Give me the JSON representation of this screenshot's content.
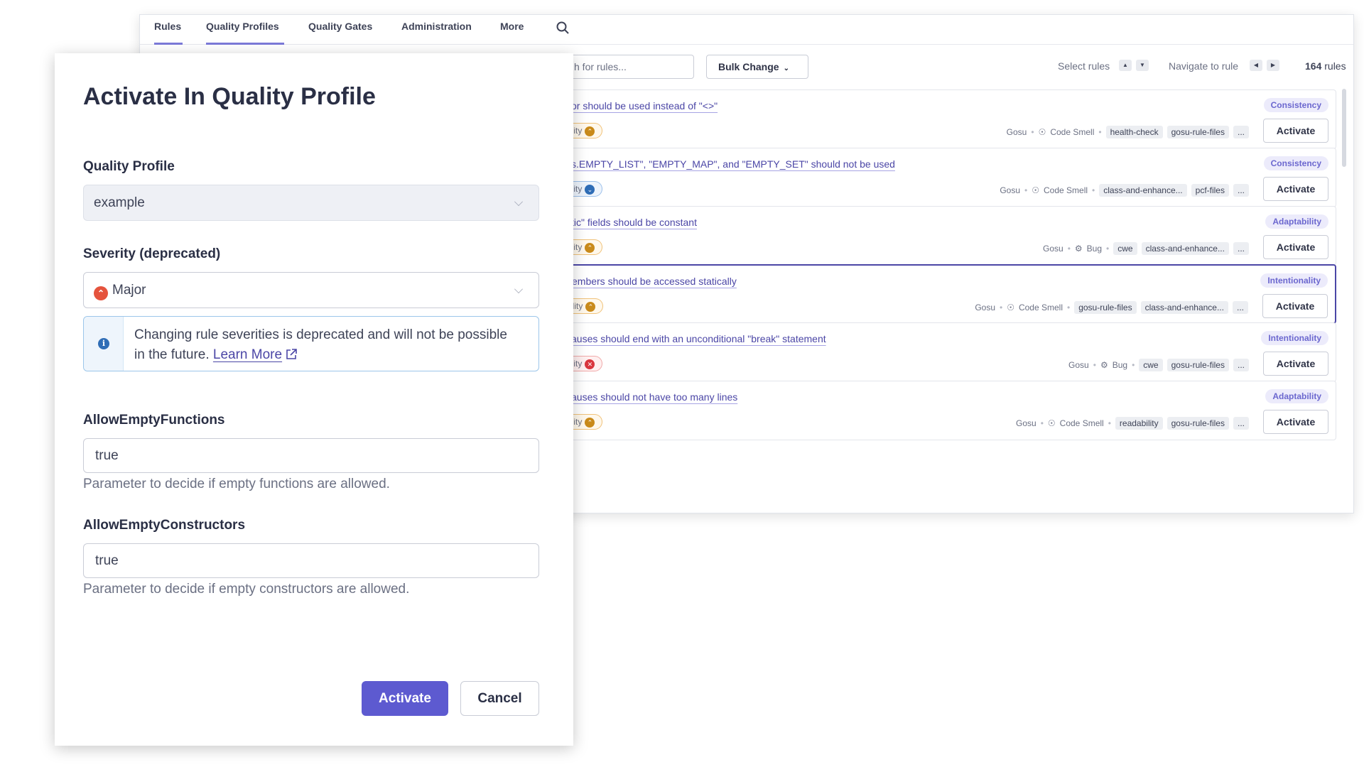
{
  "nav": {
    "tabs": [
      "Rules",
      "Quality Profiles",
      "Quality Gates",
      "Administration",
      "More"
    ]
  },
  "toolbar": {
    "search_placeholder": "h for rules...",
    "bulk_change": "Bulk Change",
    "select_rules": "Select rules",
    "navigate_to_rule": "Navigate to rule",
    "rules_count": "164",
    "rules_word": "rules"
  },
  "rules": [
    {
      "title": "or should be used instead of \"<>\"",
      "attribute": "Consistency",
      "impact": "ility",
      "impact_level": "medium",
      "meta": [
        "Gosu",
        "Code Smell"
      ],
      "tags": [
        "health-check",
        "gosu-rule-files",
        "..."
      ],
      "action": "Activate"
    },
    {
      "title": "s.EMPTY_LIST\", \"EMPTY_MAP\", and \"EMPTY_SET\" should not be used",
      "attribute": "Consistency",
      "impact": "ility",
      "impact_level": "low",
      "meta": [
        "Gosu",
        "Code Smell"
      ],
      "tags": [
        "class-and-enhance...",
        "pcf-files",
        "..."
      ],
      "action": "Activate"
    },
    {
      "title": "tic\" fields should be constant",
      "attribute": "Adaptability",
      "impact": "ility",
      "impact_level": "medium",
      "meta": [
        "Gosu",
        "Bug"
      ],
      "tags": [
        "cwe",
        "class-and-enhance...",
        "..."
      ],
      "action": "Activate"
    },
    {
      "title": "embers should be accessed statically",
      "attribute": "Intentionality",
      "impact": "ility",
      "impact_level": "medium",
      "meta": [
        "Gosu",
        "Code Smell"
      ],
      "tags": [
        "gosu-rule-files",
        "class-and-enhance...",
        "..."
      ],
      "action": "Activate"
    },
    {
      "title": "auses should end with an unconditional \"break\" statement",
      "attribute": "Intentionality",
      "impact": "ility",
      "impact_level": "high",
      "meta": [
        "Gosu",
        "Bug"
      ],
      "tags": [
        "cwe",
        "gosu-rule-files",
        "..."
      ],
      "action": "Activate"
    },
    {
      "title": "auses should not have too many lines",
      "attribute": "Adaptability",
      "impact": "ility",
      "impact_level": "medium",
      "meta": [
        "Gosu",
        "Code Smell"
      ],
      "tags": [
        "readability",
        "gosu-rule-files",
        "..."
      ],
      "action": "Activate"
    }
  ],
  "modal": {
    "title": "Activate In Quality Profile",
    "quality_profile_label": "Quality Profile",
    "quality_profile_value": "example",
    "severity_label": "Severity (deprecated)",
    "severity_value": "Major",
    "info_text_1": "Changing rule severities is deprecated and will not be possible in the future.",
    "info_link": "Learn More",
    "param1_label": "AllowEmptyFunctions",
    "param1_value": "true",
    "param1_help": "Parameter to decide if empty functions are allowed.",
    "param2_label": "AllowEmptyConstructors",
    "param2_value": "true",
    "param2_help": "Parameter to decide if empty constructors are allowed.",
    "activate_button": "Activate",
    "cancel_button": "Cancel"
  },
  "colors": {
    "accent": "#5d5ad0",
    "link": "#4b46a6",
    "severity_major": "#e5533d",
    "info": "#2f6db6"
  }
}
